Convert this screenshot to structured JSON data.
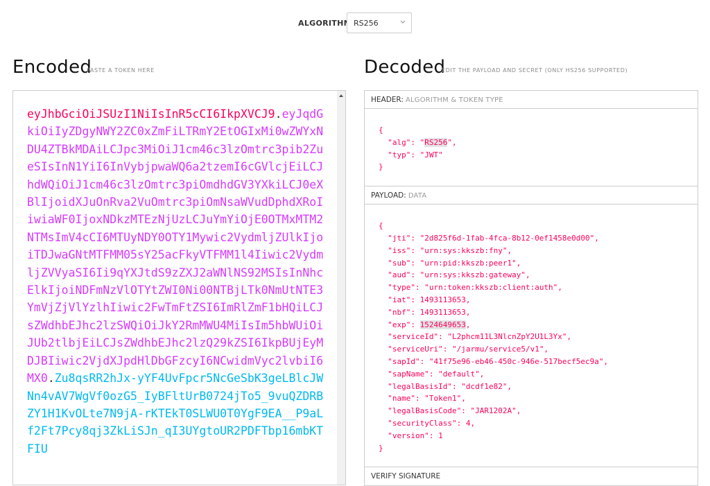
{
  "algorithm": {
    "label": "ALGORITHM",
    "selected": "RS256"
  },
  "encoded": {
    "title": "Encoded",
    "subtitle": "PASTE A TOKEN HERE",
    "header_part": "eyJhbGciOiJSUzI1NiIsInR5cCI6IkpXVCJ9",
    "dot1": ".",
    "payload_part": "eyJqdGkiOiIyZDgyNWY2ZC0xZmFiLTRmY2EtOGIxMi0wZWYxNDU4ZTBkMDAiLCJpc3MiOiJ1cm46c3lzOmtrc3pib2ZueSIsInN1YiI6InVybjpwaWQ6a2tzemI6cGVlcjEiLCJhdWQiOiJ1cm46c3lzOmtrc3piOmdhdGV3YXkiLCJ0eXBlIjoidXJuOnRva2VuOmtrc3piOmNsaWVudDphdXRoIiwiaWF0IjoxNDkzMTEzNjUzLCJuYmYiOjE0OTMxMTM2NTMsImV4cCI6MTUyNDY0OTY1Mywic2VydmljZUlkIjoiTDJwaGNtMTFMM05sY25acFkyVTFMM1l4Iiwic2VydmljZVVyaSI6Ii9qYXJtdS9zZXJ2aWNlNS92MSIsInNhcElkIjoiNDFmNzVlOTYtZWI0Ni00NTBjLTk0NmUtNTE3YmVjZjVlYzlhIiwic2FwTmFtZSI6ImRlZmF1bHQiLCJsZWdhbEJhc2lzSWQiOiJkY2RmMWU4MiIsIm5hbWUiOiJUb2tlbjEiLCJsZWdhbEJhc2lzQ29kZSI6IkpBUjEyMDJBIiwic2VjdXJpdHlDbGFzcyI6NCwidmVyc2lvbiI6MX0",
    "dot2": ".",
    "signature_part": "Zu8qsRR2hJx-yYF4UvFpcr5NcGeSbK3geLBlcJWNn4vAV7WgVf0ozG5_IyBFltUrB0724jTo5_9vuQZDRBZY1H1KvOLte7N9jA-rKTEkT0SLWU0T0YgF9EA__P9aLf2Ft7Pcy8qj3ZkLiSJn_qI3UYgtoUR2PDFTbp16mbKTFIU"
  },
  "decoded": {
    "title": "Decoded",
    "subtitle": "EDIT THE PAYLOAD AND SECRET (ONLY HS256 SUPPORTED)",
    "header": {
      "label": "HEADER:",
      "sublabel": "ALGORITHM & TOKEN TYPE",
      "open": "{",
      "close": "}",
      "lines": [
        {
          "key": "\"alg\"",
          "value": "\"RS256\"",
          "comma": ","
        },
        {
          "key": "\"typ\"",
          "value": "\"JWT\"",
          "comma": ""
        }
      ]
    },
    "payload": {
      "label": "PAYLOAD:",
      "sublabel": "DATA",
      "open": "{",
      "close": "}",
      "lines": [
        {
          "key": "\"jti\"",
          "value": "\"2d825f6d-1fab-4fca-8b12-0ef1458e0d00\"",
          "comma": ","
        },
        {
          "key": "\"iss\"",
          "value": "\"urn:sys:kkszb:fny\"",
          "comma": ","
        },
        {
          "key": "\"sub\"",
          "value": "\"urn:pid:kkszb:peer1\"",
          "comma": ","
        },
        {
          "key": "\"aud\"",
          "value": "\"urn:sys:kkszb:gateway\"",
          "comma": ","
        },
        {
          "key": "\"type\"",
          "value": "\"urn:token:kkszb:client:auth\"",
          "comma": ","
        },
        {
          "key": "\"iat\"",
          "value": "1493113653",
          "comma": ","
        },
        {
          "key": "\"nbf\"",
          "value": "1493113653",
          "comma": ","
        },
        {
          "key": "\"exp\"",
          "value": "1524649653",
          "comma": ","
        },
        {
          "key": "\"serviceId\"",
          "value": "\"L2phcm11L3NlcnZpY2U1L3Yx\"",
          "comma": ","
        },
        {
          "key": "\"serviceUri\"",
          "value": "\"/jarmu/service5/v1\"",
          "comma": ","
        },
        {
          "key": "\"sapId\"",
          "value": "\"41f75e96-eb46-450c-946e-517becf5ec9a\"",
          "comma": ","
        },
        {
          "key": "\"sapName\"",
          "value": "\"default\"",
          "comma": ","
        },
        {
          "key": "\"legalBasisId\"",
          "value": "\"dcdf1e82\"",
          "comma": ","
        },
        {
          "key": "\"name\"",
          "value": "\"Token1\"",
          "comma": ","
        },
        {
          "key": "\"legalBasisCode\"",
          "value": "\"JAR1202A\"",
          "comma": ","
        },
        {
          "key": "\"securityClass\"",
          "value": "4",
          "comma": ","
        },
        {
          "key": "\"version\"",
          "value": "1",
          "comma": ""
        }
      ]
    },
    "verify": {
      "label": "VERIFY SIGNATURE"
    }
  },
  "colors": {
    "header_part": "#fb015b",
    "payload_part": "#d63aff",
    "signature_part": "#00b9f1"
  }
}
